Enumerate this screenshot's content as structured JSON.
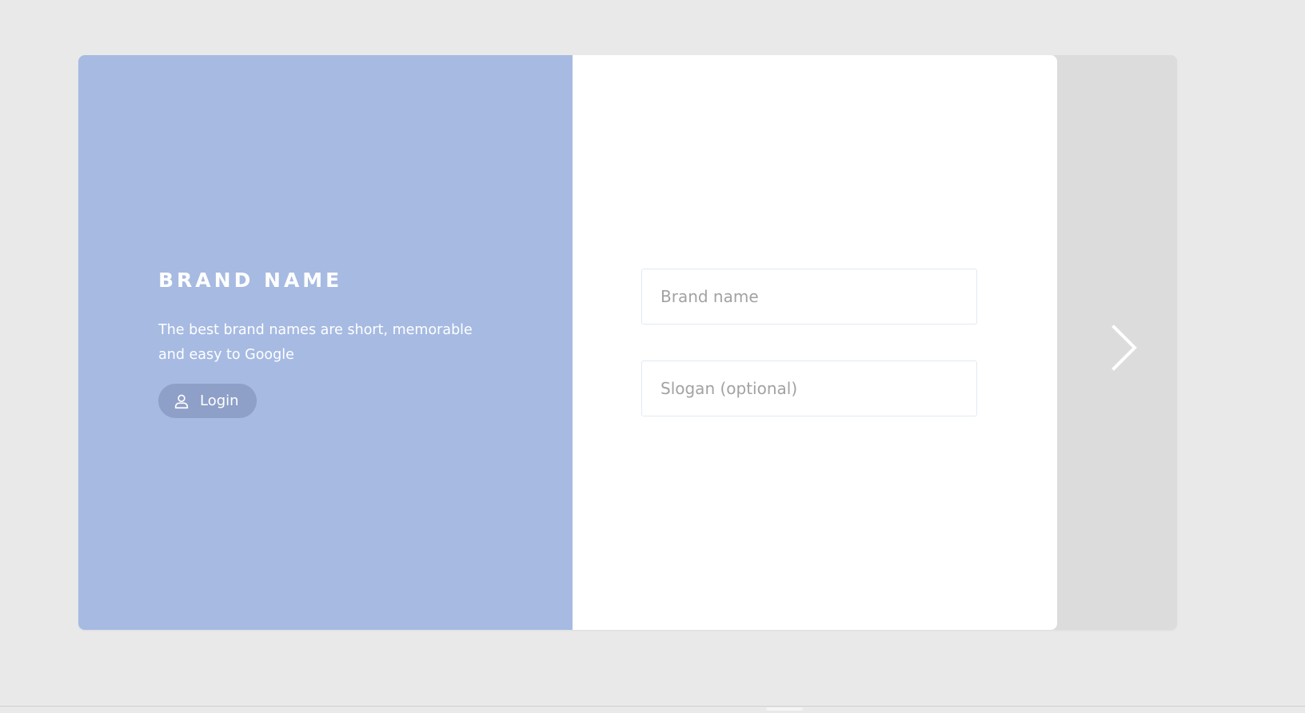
{
  "hero": {
    "title": "BRAND NAME",
    "description": "The best brand names are short, memorable and easy to Google",
    "login_label": "Login",
    "login_icon": "user-icon"
  },
  "form": {
    "brand_name_placeholder": "Brand name",
    "slogan_placeholder": "Slogan (optional)"
  },
  "nav": {
    "next_icon": "chevron-right-icon"
  },
  "colors": {
    "page_background": "#e9e9e9",
    "hero_background": "#a6bae2",
    "login_button": "#8e9fc8",
    "form_background": "#ffffff",
    "side_strip": "#dcdcdc",
    "input_border": "#e1eaf4",
    "placeholder_text": "#a2a2a2"
  }
}
